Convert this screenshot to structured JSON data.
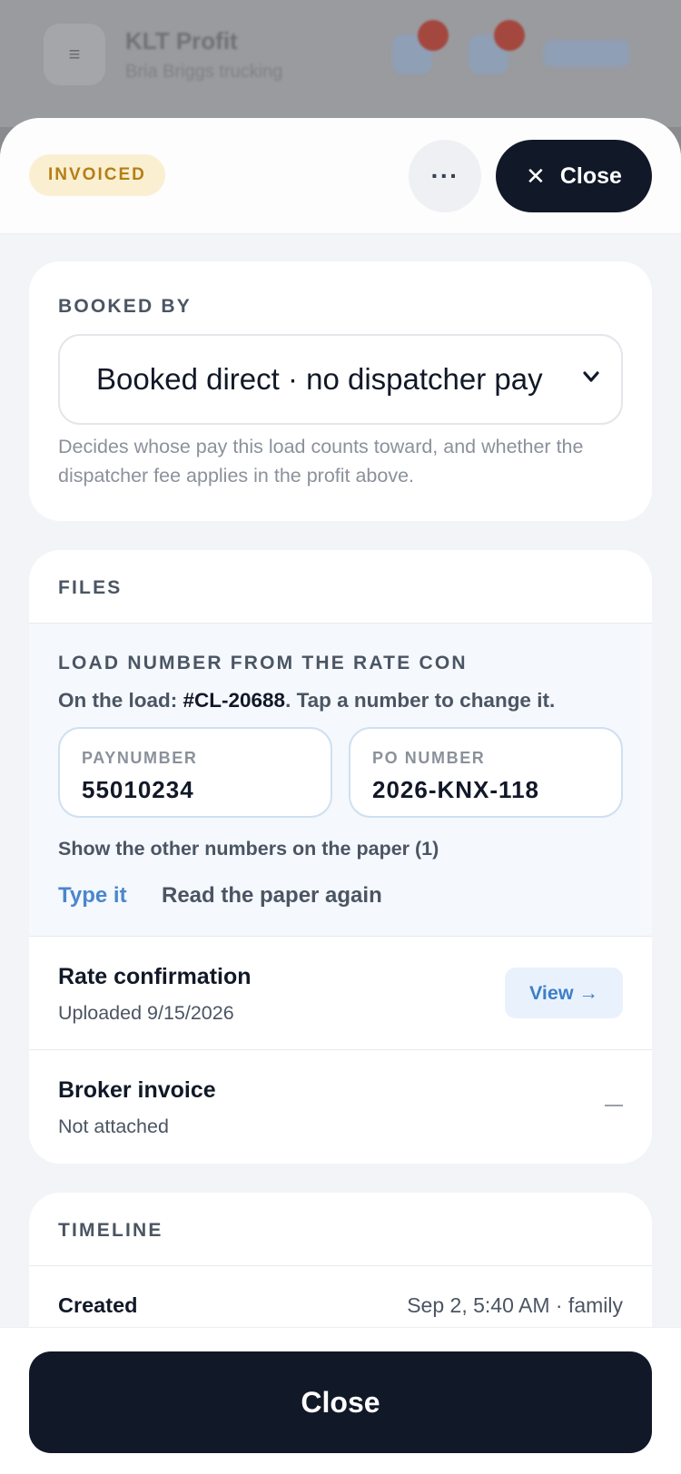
{
  "background_app": {
    "title": "KLT Profit",
    "subtitle": "Bria Briggs trucking"
  },
  "sheet": {
    "status_badge": "INVOICED",
    "more_icon": "more-horizontal-icon",
    "close_label": "Close"
  },
  "booked_by": {
    "section_label": "BOOKED BY",
    "selected_option": "Booked direct · no dispatcher pay",
    "helper_text": "Decides whose pay this load counts toward, and whether the dispatcher fee applies in the profit above."
  },
  "files": {
    "section_label": "FILES",
    "load_number": {
      "section_label": "LOAD NUMBER FROM THE RATE CON",
      "on_load_prefix": "On the load: ",
      "on_load_value": "#CL-20688",
      "on_load_suffix": ". Tap a number to change it.",
      "fields": [
        {
          "label": "PAYNUMBER",
          "value": "55010234"
        },
        {
          "label": "PO NUMBER",
          "value": "2026-KNX-118"
        }
      ],
      "show_other": "Show the other numbers on the paper (1)",
      "type_it": "Type it",
      "read_again": "Read the paper again"
    },
    "items": [
      {
        "title": "Rate confirmation",
        "subtitle": "Uploaded 9/15/2026",
        "action": "View →"
      },
      {
        "title": "Broker invoice",
        "subtitle": "Not attached",
        "action": "—"
      }
    ]
  },
  "timeline": {
    "section_label": "TIMELINE",
    "events": [
      {
        "event": "Created",
        "meta": "Sep 2, 5:40 AM · family"
      }
    ]
  },
  "footer": {
    "close_label": "Close"
  },
  "colors": {
    "primary_dark": "#111827",
    "invoiced_badge_bg": "#fbefd2",
    "invoiced_badge_text": "#b47f14",
    "link_blue": "#4a86cf"
  }
}
